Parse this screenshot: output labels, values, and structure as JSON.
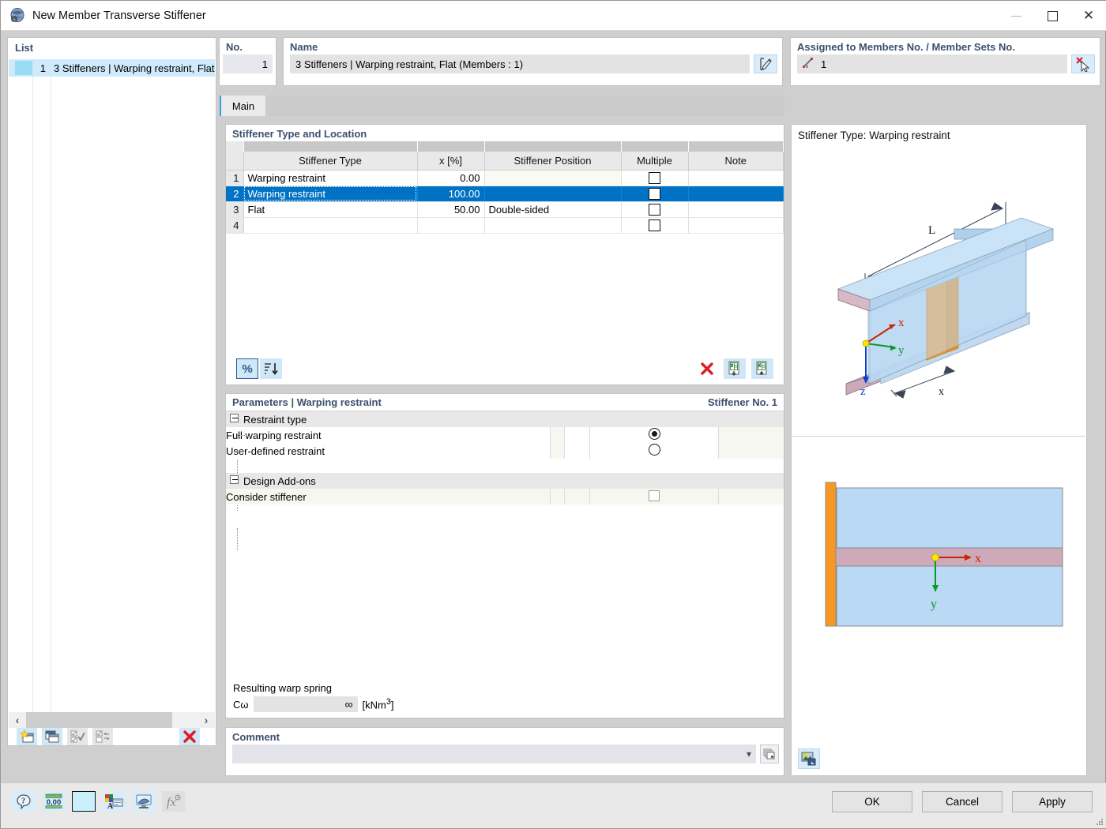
{
  "window": {
    "title": "New Member Transverse Stiffener",
    "icon": "app-icon",
    "minimize": "minimize-icon",
    "maximize": "maximize-icon",
    "close": "close-icon"
  },
  "list_panel": {
    "header": "List",
    "rows": [
      {
        "number": "1",
        "label": "3 Stiffeners | Warping restraint, Flat",
        "selected": true
      }
    ],
    "scroll_left": "‹",
    "scroll_right": "›",
    "toolbar": [
      {
        "name": "new-item-button",
        "icon": "new-window-star-icon",
        "enabled": true
      },
      {
        "name": "copy-item-button",
        "icon": "copy-windows-icon",
        "enabled": true
      },
      {
        "name": "select-all-button",
        "icon": "select-all-icon",
        "enabled": false
      },
      {
        "name": "invert-selection-button",
        "icon": "invert-selection-icon",
        "enabled": false
      },
      {
        "name": "delete-item-button",
        "icon": "red-x-icon",
        "enabled": true
      }
    ]
  },
  "no_panel": {
    "header": "No.",
    "value": "1"
  },
  "name_panel": {
    "header": "Name",
    "value": "3 Stiffeners | Warping restraint, Flat (Members : 1)",
    "edit_icon": "edit-pencil-icon"
  },
  "assigned_panel": {
    "header": "Assigned to Members No. / Member Sets No.",
    "value": "1",
    "member_icon": "member-line-icon",
    "pick_icon": "pick-cursor-icon"
  },
  "tabs": [
    {
      "label": "Main",
      "active": true
    }
  ],
  "stiffener_section": {
    "header": "Stiffener Type and Location",
    "columns": [
      "",
      "Stiffener Type",
      "x [%]",
      "Stiffener Position",
      "Multiple",
      "Note"
    ],
    "rows": [
      {
        "no": "1",
        "type": "Warping restraint",
        "x": "0.00",
        "position": "",
        "multiple": false,
        "note": "",
        "selected": false
      },
      {
        "no": "2",
        "type": "Warping restraint",
        "x": "100.00",
        "position": "",
        "multiple": false,
        "note": "",
        "selected": true
      },
      {
        "no": "3",
        "type": "Flat",
        "x": "50.00",
        "position": "Double-sided",
        "multiple": false,
        "note": "",
        "selected": false
      },
      {
        "no": "4",
        "type": "",
        "x": "",
        "position": "",
        "multiple": false,
        "note": "",
        "selected": false
      }
    ],
    "toolbar": {
      "percent_label": "%",
      "percent_name": "relative-coordinates-button",
      "sort_name": "sort-rows-button",
      "delete_name": "delete-row-button",
      "import_name": "import-from-excel-button",
      "export_name": "export-to-excel-button"
    }
  },
  "parameters": {
    "title": "Parameters | Warping restraint",
    "subtitle": "Stiffener No. 1",
    "groups": [
      {
        "label": "Restraint type",
        "items": [
          {
            "label": "Full warping restraint",
            "control": "radio",
            "checked": true
          },
          {
            "label": "User-defined restraint",
            "control": "radio",
            "checked": false
          }
        ]
      },
      {
        "label": "Design Add-ons",
        "items": [
          {
            "label": "Consider stiffener",
            "control": "checkbox",
            "checked": false
          }
        ]
      }
    ],
    "warp_spring": {
      "title": "Resulting warp spring",
      "symbol": "Cω",
      "value": "∞",
      "unit_prefix": "[kNm",
      "unit_exponent": "3",
      "unit_suffix": "]"
    }
  },
  "comment": {
    "header": "Comment",
    "value": "",
    "placeholder": "",
    "dropdown_icon": "chevron-down-icon",
    "pick_icon": "comment-library-icon"
  },
  "graphic": {
    "title": "Stiffener Type: Warping restraint",
    "labels_3d": {
      "length": "L",
      "offset": "x",
      "axis_x": "x",
      "axis_y": "y",
      "axis_z": "z"
    },
    "labels_2d": {
      "axis_x": "x",
      "axis_y": "y"
    },
    "snapshot_icon": "snapshot-image-icon",
    "colors": {
      "flange": "#c4a9b8",
      "web": "#b9d9f4",
      "stiffener": "#f79824",
      "axis_x": "#cc2200",
      "axis_y": "#0a9a2a",
      "axis_z": "#0b3fcc"
    }
  },
  "bottom_bar": {
    "tools": [
      {
        "name": "help-button",
        "icon": "help-bubble-icon",
        "enabled": true
      },
      {
        "name": "units-button",
        "icon": "units-ruler-icon",
        "enabled": true
      },
      {
        "name": "color-swatch-button",
        "icon": "color-swatch-icon",
        "enabled": true
      },
      {
        "name": "display-properties-button",
        "icon": "display-properties-icon",
        "enabled": true
      },
      {
        "name": "render-view-button",
        "icon": "render-view-icon",
        "enabled": true
      },
      {
        "name": "formula-button",
        "icon": "fx-formula-icon",
        "enabled": false
      }
    ],
    "buttons": [
      {
        "name": "ok-button",
        "label": "OK"
      },
      {
        "name": "cancel-button",
        "label": "Cancel"
      },
      {
        "name": "apply-button",
        "label": "Apply"
      }
    ]
  }
}
